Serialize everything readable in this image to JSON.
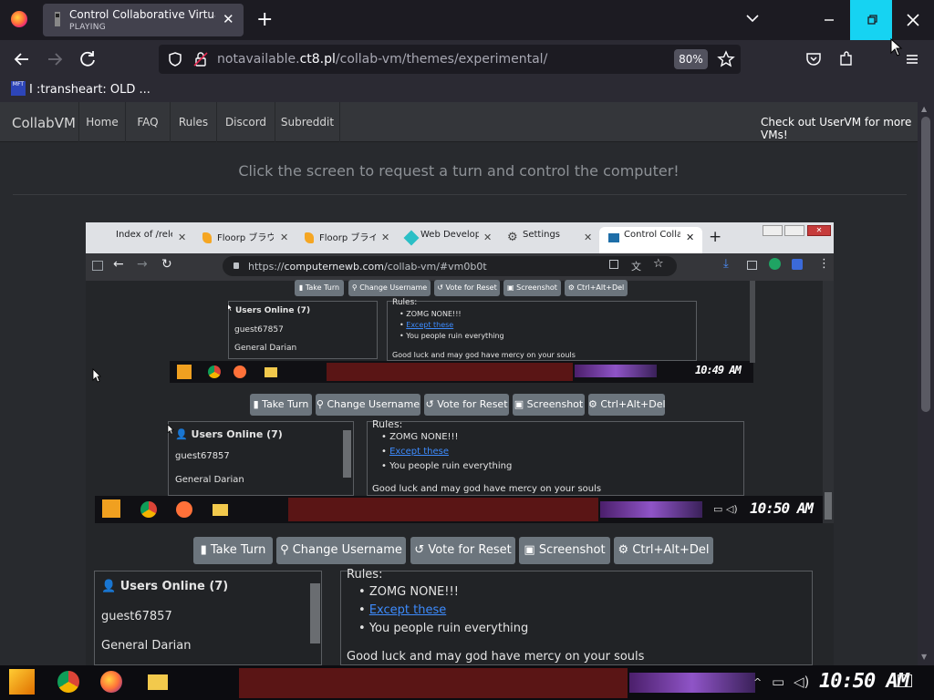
{
  "browser": {
    "tab": {
      "title": "Control Collaborative Virtual Machines",
      "status": "PLAYING"
    },
    "url": {
      "prefix": "notavailable.",
      "domain": "ct8.pl",
      "path": "/collab-vm/themes/experimental/"
    },
    "zoom": "80%",
    "bookmark": {
      "icon_text": "MFT",
      "label": "I :transheart: OLD ..."
    }
  },
  "site": {
    "brand": "CollabVM",
    "nav": [
      "Home",
      "FAQ",
      "Rules",
      "Discord",
      "Subreddit"
    ],
    "right_link": "Check out UserVM for more VMs!",
    "instruction": "Click the screen to request a turn and control the computer!"
  },
  "vm_browser": {
    "tabs": [
      "Index of /relea",
      "Floorp ブラウ",
      "Floorp ブライ",
      "Web Developer",
      "Settings",
      "Control Collab"
    ],
    "url_prefix": "https://",
    "url_domain": "computernewb.com",
    "url_path": "/collab-vm/#vm0b0t"
  },
  "controls": {
    "take_turn": "Take Turn",
    "change_username": "Change Username",
    "vote_reset": "Vote for Reset",
    "screenshot": "Screenshot",
    "ctrl_alt_del": "Ctrl+Alt+Del"
  },
  "users": {
    "header": "Users Online (7)",
    "list": [
      "guest67857",
      "General Darian"
    ]
  },
  "rules": {
    "header": "Rules:",
    "items": [
      "ZOMG NONE!!!",
      "Except these",
      "You people ruin everything"
    ],
    "footer": "Good luck and may god have mercy on your souls"
  },
  "clocks": [
    "10:49 AM",
    "10:50 AM",
    "10:50 AM"
  ]
}
